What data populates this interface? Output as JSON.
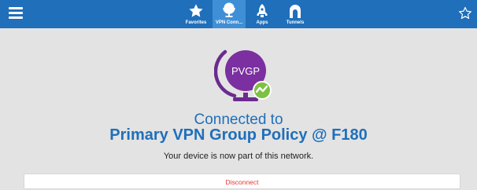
{
  "colors": {
    "topbar": "#1f6fba",
    "active_tab": "#3f8fd6",
    "background": "#e3e3e3",
    "heading": "#1f6fba",
    "disconnect_text": "#e53935",
    "logo_purple": "#7b2fa0",
    "status_green": "#7cc142"
  },
  "header": {
    "menu_icon": "hamburger-icon",
    "favorite_icon": "star-outline-icon",
    "tabs": [
      {
        "label": "Favorites",
        "icon": "star-icon",
        "active": false
      },
      {
        "label": "VPN Conn...",
        "icon": "globe-icon",
        "active": true
      },
      {
        "label": "Apps",
        "icon": "rocket-icon",
        "active": false
      },
      {
        "label": "Tunnels",
        "icon": "tunnel-icon",
        "active": false
      }
    ]
  },
  "main": {
    "logo_text": "PVGP",
    "logo_icon": "globe-stand-icon",
    "status_icon": "connected-wave-icon",
    "connected_text": "Connected to",
    "policy_name": "Primary VPN Group Policy @ F180",
    "description": "Your device is now part of this network.",
    "disconnect_label": "Disconnect"
  }
}
